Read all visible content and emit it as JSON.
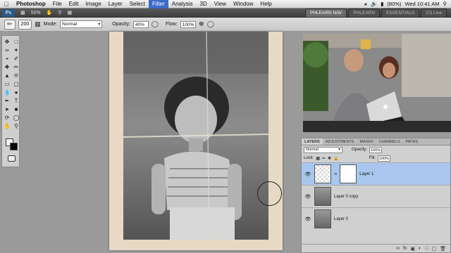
{
  "menubar": {
    "app": "Photoshop",
    "items": [
      "File",
      "Edit",
      "Image",
      "Layer",
      "Select",
      "Filter",
      "Analysis",
      "3D",
      "View",
      "Window",
      "Help"
    ],
    "active_index": 5,
    "battery": "(80%)",
    "clock": "Wed 10:41 AM"
  },
  "appbar": {
    "logo": "Ps",
    "zoom": "50%",
    "workspaces": [
      "PHLEARN NAV",
      "PHLEARN",
      "ESSENTIALS"
    ],
    "cs_live": "CS Live"
  },
  "options": {
    "brush_size": "200",
    "mode_label": "Mode:",
    "mode_value": "Normal",
    "opacity_label": "Opacity:",
    "opacity_value": "40%",
    "flow_label": "Flow:",
    "flow_value": "100%"
  },
  "panels": {
    "tabs": [
      "LAYERS",
      "ADJUSTMENTS",
      "MASKS",
      "CHANNELS",
      "PATHS"
    ],
    "blend_mode": "Normal",
    "opacity_label": "Opacity:",
    "opacity_value": "100%",
    "lock_label": "Lock:",
    "fill_label": "Fill:",
    "fill_value": "100%",
    "layers": [
      {
        "name": "Layer 1",
        "selected": true
      },
      {
        "name": "Layer 0 copy",
        "selected": false
      },
      {
        "name": "Layer 0",
        "selected": false
      }
    ]
  },
  "colors": {
    "menu_highlight": "#3b6cc9",
    "selected_layer": "#a9c7ee"
  }
}
